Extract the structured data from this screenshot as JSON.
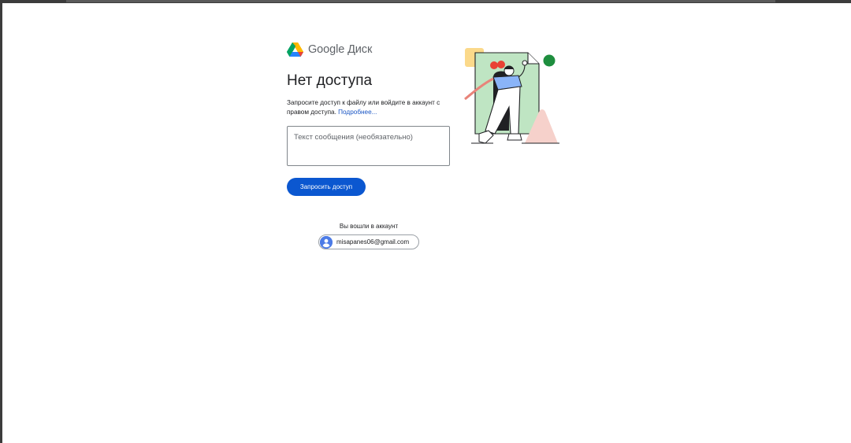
{
  "header": {
    "brand_text": "Google Диск",
    "logo_icon": "google-drive-logo-icon"
  },
  "main": {
    "title": "Нет доступа",
    "description": "Запросите доступ к файлу или войдите в аккаунт с правом доступа.",
    "learn_more_link": "Подробнее...",
    "message_placeholder": "Текст сообщения (необязательно)",
    "request_button_label": "Запросить доступ"
  },
  "account": {
    "signed_in_label": "Вы вошли в аккаунт",
    "email": "misapanes06@gmail.com",
    "avatar_icon": "account-circle-icon"
  },
  "colors": {
    "accent": "#0b57d0",
    "link": "#1a56c4",
    "illustration_green": "#bfe5c3",
    "illustration_dot": "#1e8e3e"
  }
}
